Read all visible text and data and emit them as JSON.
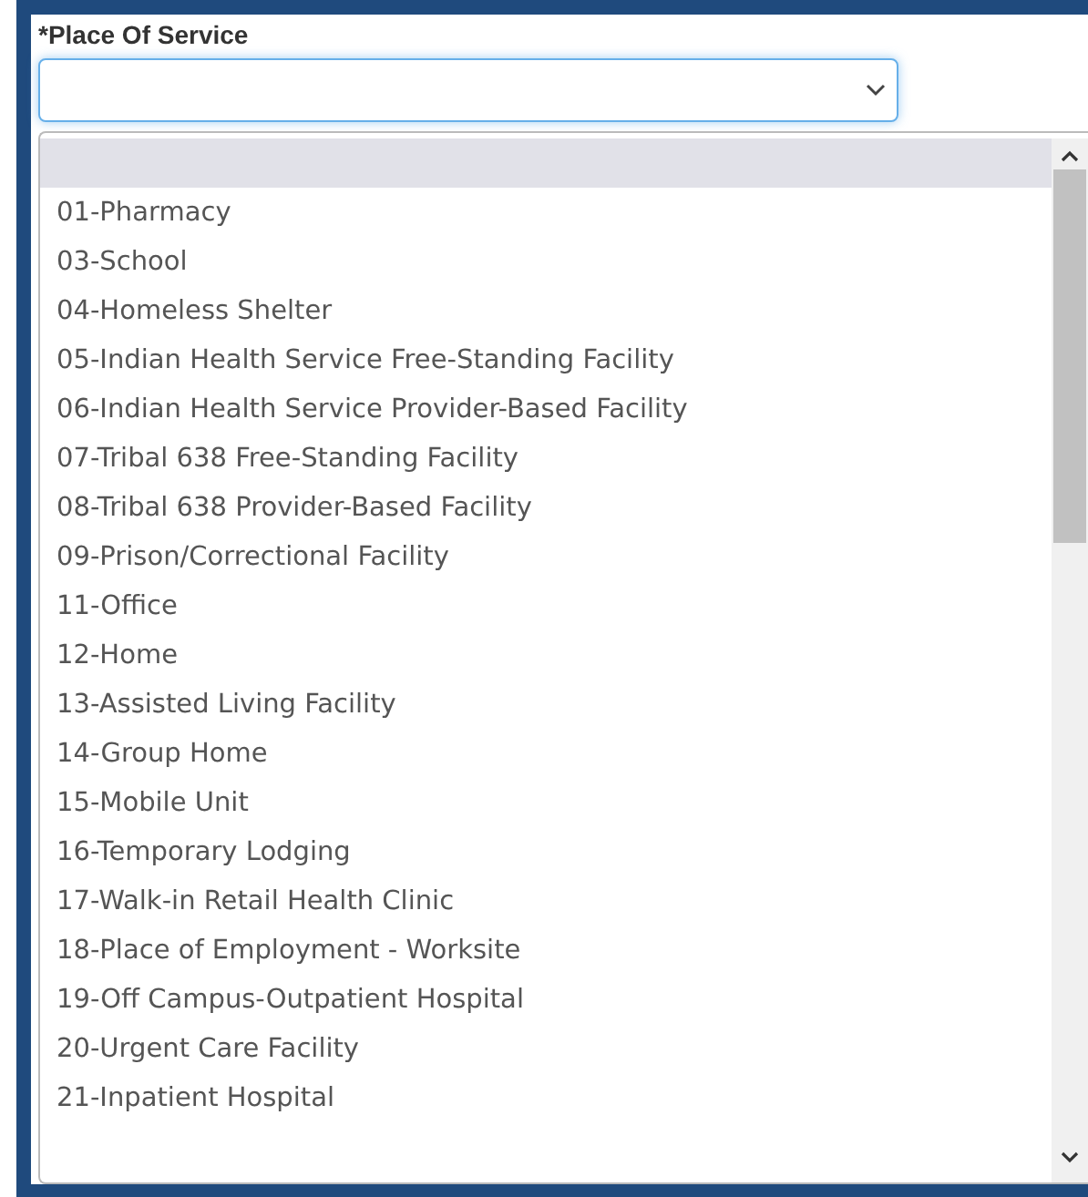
{
  "field": {
    "label": "*Place Of Service",
    "focused": true,
    "expanded": true
  },
  "options": [
    {
      "kind": "blank",
      "selected": true
    },
    {
      "kind": "option",
      "label": "01-Pharmacy",
      "selected": false
    },
    {
      "kind": "option",
      "label": "03-School",
      "selected": false
    },
    {
      "kind": "option",
      "label": "04-Homeless Shelter",
      "selected": false
    },
    {
      "kind": "option",
      "label": "05-Indian Health Service Free-Standing Facility",
      "selected": false
    },
    {
      "kind": "option",
      "label": "06-Indian Health Service Provider-Based Facility",
      "selected": false
    },
    {
      "kind": "option",
      "label": "07-Tribal 638 Free-Standing Facility",
      "selected": false
    },
    {
      "kind": "option",
      "label": "08-Tribal 638 Provider-Based Facility",
      "selected": false
    },
    {
      "kind": "option",
      "label": "09-Prison/Correctional Facility",
      "selected": false
    },
    {
      "kind": "option",
      "label": "11-Office",
      "selected": false
    },
    {
      "kind": "option",
      "label": "12-Home",
      "selected": false
    },
    {
      "kind": "option",
      "label": "13-Assisted Living Facility",
      "selected": false
    },
    {
      "kind": "option",
      "label": "14-Group Home",
      "selected": false
    },
    {
      "kind": "option",
      "label": "15-Mobile Unit",
      "selected": false
    },
    {
      "kind": "option",
      "label": "16-Temporary Lodging",
      "selected": false
    },
    {
      "kind": "option",
      "label": "17-Walk-in Retail Health Clinic",
      "selected": false
    },
    {
      "kind": "option",
      "label": "18-Place of Employment - Worksite",
      "selected": false
    },
    {
      "kind": "option",
      "label": "19-Off Campus-Outpatient Hospital",
      "selected": false
    },
    {
      "kind": "option",
      "label": "20-Urgent Care Facility",
      "selected": false
    },
    {
      "kind": "option",
      "label": "21-Inpatient Hospital",
      "selected": false
    }
  ]
}
